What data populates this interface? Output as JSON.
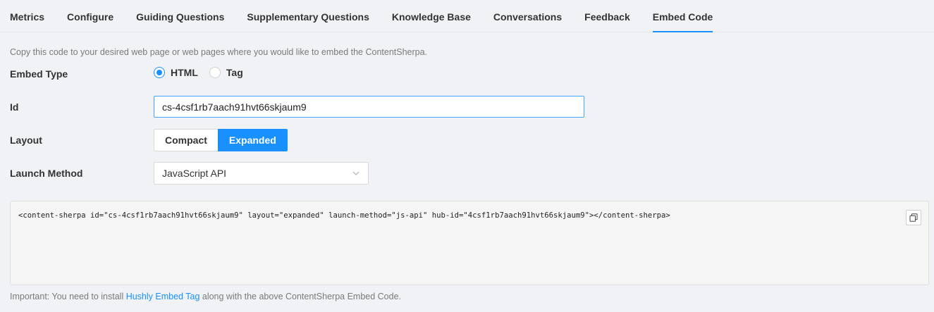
{
  "tabs": [
    {
      "label": "Metrics",
      "active": false
    },
    {
      "label": "Configure",
      "active": false
    },
    {
      "label": "Guiding Questions",
      "active": false
    },
    {
      "label": "Supplementary Questions",
      "active": false
    },
    {
      "label": "Knowledge Base",
      "active": false
    },
    {
      "label": "Conversations",
      "active": false
    },
    {
      "label": "Feedback",
      "active": false
    },
    {
      "label": "Embed Code",
      "active": true
    }
  ],
  "description": "Copy this code to your desired web page or web pages where you would like to embed the ContentSherpa.",
  "form": {
    "embed_type": {
      "label": "Embed Type",
      "options": [
        {
          "label": "HTML",
          "checked": true
        },
        {
          "label": "Tag",
          "checked": false
        }
      ]
    },
    "id": {
      "label": "Id",
      "value": "cs-4csf1rb7aach91hvt66skjaum9"
    },
    "layout": {
      "label": "Layout",
      "options": [
        {
          "label": "Compact",
          "active": false
        },
        {
          "label": "Expanded",
          "active": true
        }
      ]
    },
    "launch_method": {
      "label": "Launch Method",
      "value": "JavaScript API"
    }
  },
  "code": "<content-sherpa id=\"cs-4csf1rb7aach91hvt66skjaum9\" layout=\"expanded\" launch-method=\"js-api\" hub-id=\"4csf1rb7aach91hvt66skjaum9\"></content-sherpa>",
  "note": {
    "prefix": "Important: You need to install ",
    "link": "Hushly Embed Tag",
    "suffix": " along with the above ContentSherpa Embed Code."
  },
  "colors": {
    "accent": "#1890ff",
    "background": "#f0f2f5"
  },
  "icons": {
    "copy": "copy-icon",
    "dropdown": "chevron-down-icon"
  }
}
